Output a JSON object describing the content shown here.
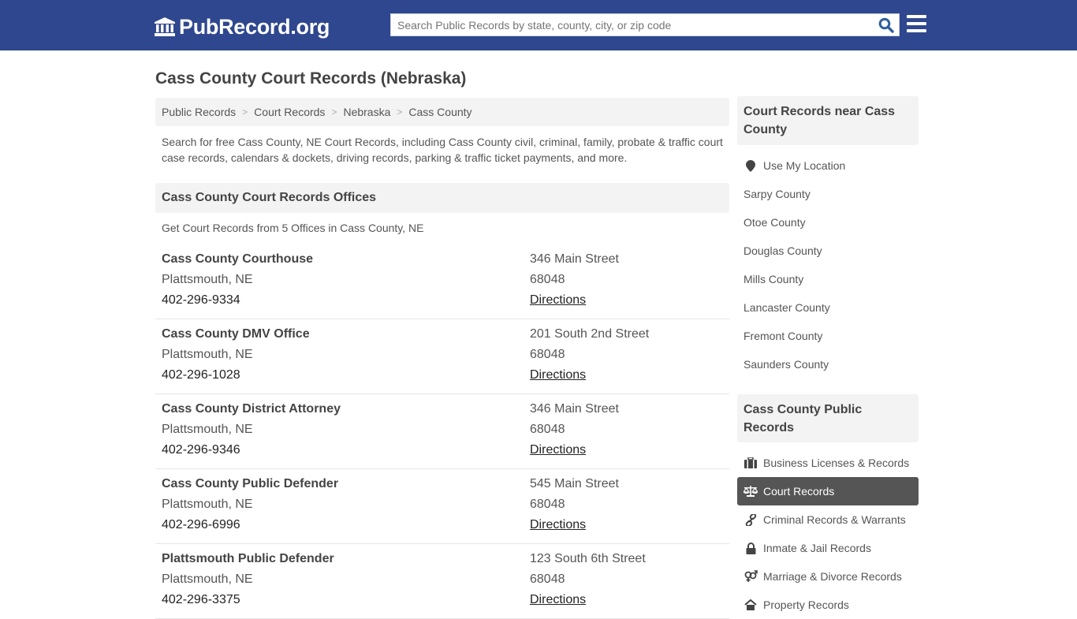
{
  "header": {
    "logo_text": "PubRecord.org",
    "logo_icon": "courthouse-icon",
    "search_placeholder": "Search Public Records by state, county, city, or zip code",
    "search_value": "",
    "search_icon": "search-icon",
    "menu_icon": "hamburger-menu-icon",
    "brand_color": "#2f478e"
  },
  "page": {
    "title": "Cass County Court Records (Nebraska)",
    "breadcrumb": [
      {
        "label": "Public Records"
      },
      {
        "label": "Court Records"
      },
      {
        "label": "Nebraska"
      },
      {
        "label": "Cass County"
      }
    ],
    "breadcrumb_separator": ">",
    "intro": "Search for free Cass County, NE Court Records, including Cass County civil, criminal, family, probate & traffic court case records, calendars & dockets, driving records, parking & traffic ticket payments, and more.",
    "offices_heading": "Cass County Court Records Offices",
    "offices_subheading": "Get Court Records from 5 Offices in Cass County, NE",
    "offices": [
      {
        "name": "Cass County Courthouse",
        "city": "Plattsmouth, NE",
        "phone": "402-296-9334",
        "address": "346 Main Street",
        "zip": "68048",
        "directions": "Directions"
      },
      {
        "name": "Cass County DMV Office",
        "city": "Plattsmouth, NE",
        "phone": "402-296-1028",
        "address": "201 South 2nd Street",
        "zip": "68048",
        "directions": "Directions"
      },
      {
        "name": "Cass County District Attorney",
        "city": "Plattsmouth, NE",
        "phone": "402-296-9346",
        "address": "346 Main Street",
        "zip": "68048",
        "directions": "Directions"
      },
      {
        "name": "Cass County Public Defender",
        "city": "Plattsmouth, NE",
        "phone": "402-296-6996",
        "address": "545 Main Street",
        "zip": "68048",
        "directions": "Directions"
      },
      {
        "name": "Plattsmouth Public Defender",
        "city": "Plattsmouth, NE",
        "phone": "402-296-3375",
        "address": "123 South 6th Street",
        "zip": "68048",
        "directions": "Directions"
      }
    ]
  },
  "sidebar": {
    "nearby_heading": "Court Records near Cass County",
    "use_location": {
      "label": "Use My Location",
      "icon": "map-marker-icon"
    },
    "nearby": [
      {
        "label": "Sarpy County"
      },
      {
        "label": "Otoe County"
      },
      {
        "label": "Douglas County"
      },
      {
        "label": "Mills County"
      },
      {
        "label": "Lancaster County"
      },
      {
        "label": "Fremont County"
      },
      {
        "label": "Saunders County"
      }
    ],
    "public_heading": "Cass County Public Records",
    "public_records": [
      {
        "label": "Business Licenses & Records",
        "icon": "briefcase-icon",
        "active": false
      },
      {
        "label": "Court Records",
        "icon": "balance-scale-icon",
        "active": true
      },
      {
        "label": "Criminal Records & Warrants",
        "icon": "link-icon",
        "active": false
      },
      {
        "label": "Inmate & Jail Records",
        "icon": "lock-icon",
        "active": false
      },
      {
        "label": "Marriage & Divorce Records",
        "icon": "gender-icon",
        "active": false
      },
      {
        "label": "Property Records",
        "icon": "home-icon",
        "active": false
      }
    ],
    "active_color": "#555555"
  }
}
